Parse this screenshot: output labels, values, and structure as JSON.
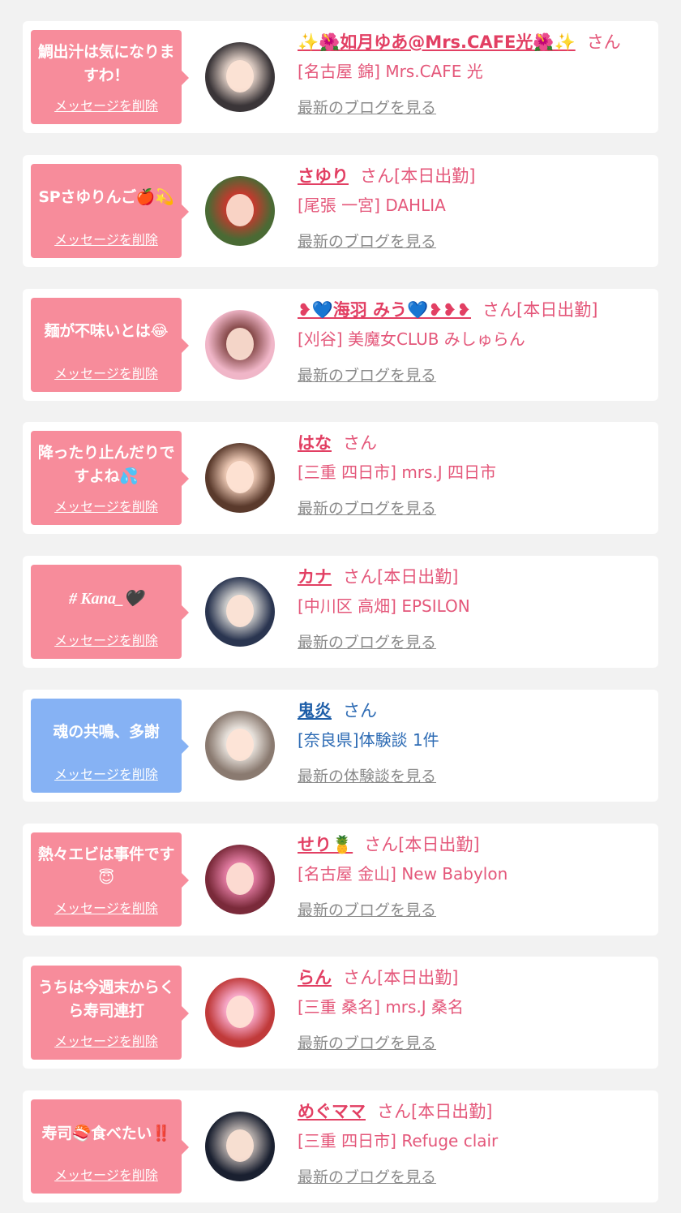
{
  "delete_label": "メッセージを削除",
  "colors": {
    "pink_bubble": "#f78c9b",
    "blue_bubble": "#86b2f4",
    "pink_text": "#e4577a",
    "blue_text": "#1e5ea8",
    "link_gray": "#8a8a8a",
    "card_bg": "#ffffff",
    "page_bg": "#f2f2f2"
  },
  "items": [
    {
      "message": "鯛出汁は気になりますわ！",
      "name": "✨🌺如月ゆあ@Mrs.CAFE光🌺✨",
      "suffix": "さん",
      "shop": "[名古屋 錦] Mrs.CAFE 光",
      "link": "最新のブログを見る",
      "theme": "pink",
      "avatar_colors": [
        "#3a3538",
        "#d8c7be"
      ]
    },
    {
      "message": "SPさゆりんご🍎💫",
      "name": "さゆり",
      "suffix": "さん[本日出勤]",
      "shop": "[尾張 一宮] DAHLIA",
      "link": "最新のブログを見る",
      "theme": "pink",
      "avatar_colors": [
        "#4a6a34",
        "#c23a2e"
      ]
    },
    {
      "message": "麺が不味いとは😂",
      "name": "❥💙海羽 みう💙❥❥❥",
      "suffix": "さん[本日出勤]",
      "shop": "[刈谷] 美魔女CLUB みしゅらん",
      "link": "最新のブログを見る",
      "theme": "pink",
      "avatar_colors": [
        "#f0b6c8",
        "#8a4e4e"
      ]
    },
    {
      "message": "降ったり止んだりですよね💦",
      "name": "はな",
      "suffix": "さん",
      "shop": "[三重 四日市] mrs.J 四日市",
      "link": "最新のブログを見る",
      "theme": "pink",
      "avatar_colors": [
        "#5a3a2c",
        "#e8c4b0"
      ]
    },
    {
      "message": "# Kana_🖤",
      "name": "カナ",
      "suffix": "さん[本日出勤]",
      "shop": "[中川区 高畑] EPSILON",
      "link": "最新のブログを見る",
      "theme": "pink",
      "avatar_colors": [
        "#2a3550",
        "#c8c8c8"
      ]
    },
    {
      "message": "魂の共鳴、多謝",
      "name": "鬼炎",
      "suffix": "さん",
      "shop": "[奈良県]体験談 1件",
      "link": "最新の体験談を見る",
      "theme": "blue",
      "avatar_colors": [
        "#8a7a70",
        "#e6e0da"
      ]
    },
    {
      "message": "熱々エビは事件です😇",
      "name": "せり🍍",
      "suffix": "さん[本日出勤]",
      "shop": "[名古屋 金山] New Babylon",
      "link": "最新のブログを見る",
      "theme": "pink",
      "avatar_colors": [
        "#7a2a3a",
        "#e07aa0"
      ]
    },
    {
      "message": "うちは今週末からくら寿司連打",
      "name": "らん",
      "suffix": "さん[本日出勤]",
      "shop": "[三重 桑名] mrs.J 桑名",
      "link": "最新のブログを見る",
      "theme": "pink",
      "avatar_colors": [
        "#c03a3a",
        "#f6a6c6"
      ]
    },
    {
      "message": "寿司🍣食べたい‼️",
      "name": "めぐママ",
      "suffix": "さん[本日出勤]",
      "shop": "[三重 四日市] Refuge clair",
      "link": "最新のブログを見る",
      "theme": "pink",
      "avatar_colors": [
        "#1a2030",
        "#b0a8a6"
      ]
    }
  ]
}
